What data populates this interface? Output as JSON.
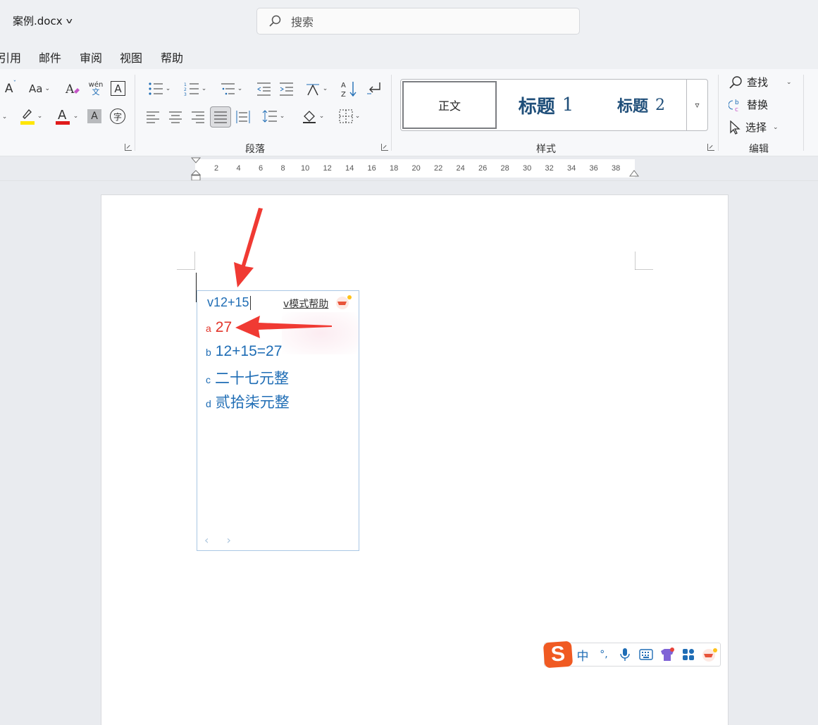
{
  "titlebar": {
    "doc_name": "案例.docx",
    "search_placeholder": "搜索"
  },
  "menu": [
    "引用",
    "邮件",
    "审阅",
    "视图",
    "帮助"
  ],
  "ribbon": {
    "groups": {
      "paragraph": "段落",
      "styles": "样式",
      "editing": "编辑"
    },
    "font": {
      "grow_label": "A",
      "case_label": "Aa",
      "pinyin_top": "wén",
      "pinyin_bottom": "文",
      "border_char": "A",
      "color_char": "A",
      "shade_char": "A",
      "enclose_char": "字",
      "highlight_color": "#ffe600",
      "font_color": "#e01b1b"
    },
    "styles": {
      "normal": "正文",
      "h1": "标题",
      "h1_num": "1",
      "h2": "标题",
      "h2_num": "2"
    },
    "editing": {
      "find": "查找",
      "replace": "替换",
      "select": "选择"
    }
  },
  "ruler": {
    "ticks": [
      "2",
      "4",
      "6",
      "8",
      "10",
      "12",
      "14",
      "16",
      "18",
      "20",
      "22",
      "24",
      "26",
      "28",
      "30",
      "32",
      "34",
      "36",
      "38"
    ]
  },
  "ime": {
    "input": "v12+15",
    "help": "v模式帮助",
    "candidates": [
      {
        "key": "a",
        "text": "27"
      },
      {
        "key": "b",
        "text": "12+15=27"
      },
      {
        "key": "c",
        "text": "二十七元整"
      },
      {
        "key": "d",
        "text": "贰拾柒元整"
      }
    ],
    "nav": "‹ ›"
  },
  "sogou": {
    "logo": "S",
    "lang": "中",
    "punct": "°,",
    "mic": "mic-icon",
    "keyboard": "keyboard-icon",
    "skin": "shirt-icon",
    "apps": "apps-icon",
    "mascot": "mascot-icon"
  },
  "colors": {
    "accent_red": "#e2352a",
    "ime_blue": "#1f6db5",
    "sogou_orange": "#f05a22",
    "arrow_red": "#f03a33"
  }
}
